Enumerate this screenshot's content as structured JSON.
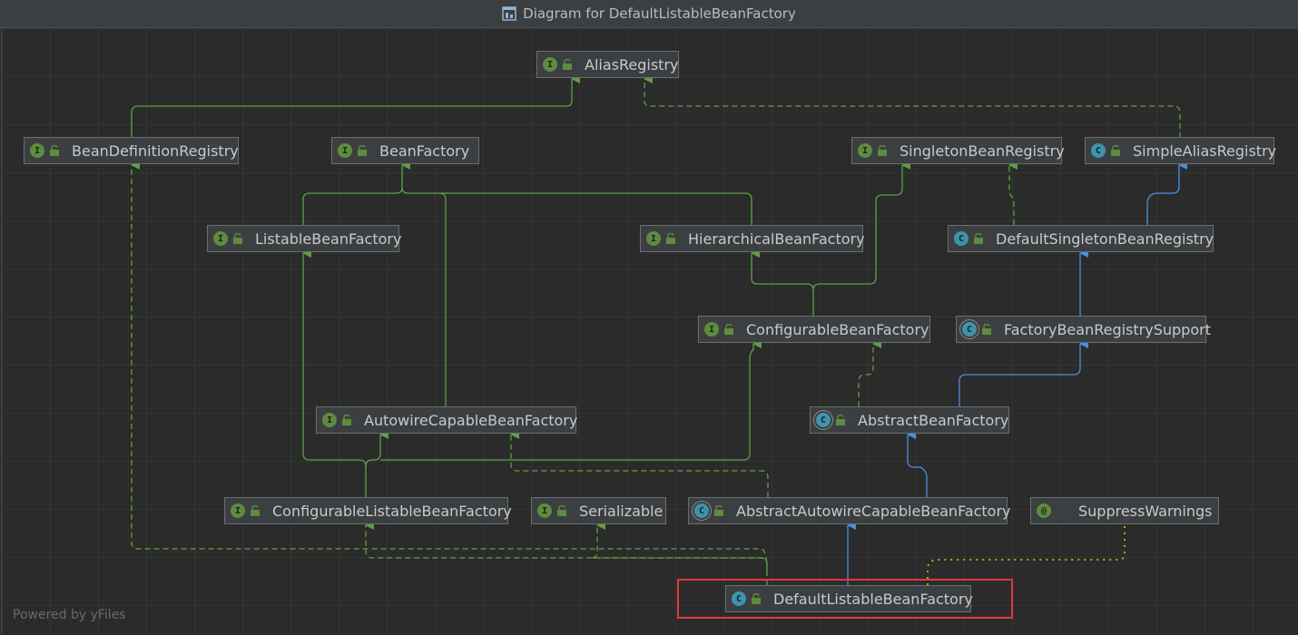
{
  "window": {
    "title": "Diagram for DefaultListableBeanFactory"
  },
  "footer": {
    "powered_by": "Powered by yFiles"
  },
  "colors": {
    "interface_badge": "#5d8c3e",
    "class_badge": "#3e93ad",
    "implements_edge": "#5fa044",
    "extends_edge": "#4a8fe0",
    "annotation_edge": "#b0b000",
    "highlight": "#e03a3a"
  },
  "nodes": {
    "alias_registry": {
      "label": "AliasRegistry",
      "kind": "interface"
    },
    "bean_definition_registry": {
      "label": "BeanDefinitionRegistry",
      "kind": "interface"
    },
    "bean_factory": {
      "label": "BeanFactory",
      "kind": "interface"
    },
    "singleton_bean_registry": {
      "label": "SingletonBeanRegistry",
      "kind": "interface"
    },
    "simple_alias_registry": {
      "label": "SimpleAliasRegistry",
      "kind": "class"
    },
    "listable_bean_factory": {
      "label": "ListableBeanFactory",
      "kind": "interface"
    },
    "hierarchical_bean_factory": {
      "label": "HierarchicalBeanFactory",
      "kind": "interface"
    },
    "default_singleton_bean_registry": {
      "label": "DefaultSingletonBeanRegistry",
      "kind": "class"
    },
    "configurable_bean_factory": {
      "label": "ConfigurableBeanFactory",
      "kind": "interface"
    },
    "factory_bean_registry_support": {
      "label": "FactoryBeanRegistrySupport",
      "kind": "abstract-class"
    },
    "autowire_capable_bean_factory": {
      "label": "AutowireCapableBeanFactory",
      "kind": "interface"
    },
    "abstract_bean_factory": {
      "label": "AbstractBeanFactory",
      "kind": "abstract-class"
    },
    "configurable_listable_bean_factory": {
      "label": "ConfigurableListableBeanFactory",
      "kind": "interface"
    },
    "serializable": {
      "label": "Serializable",
      "kind": "interface"
    },
    "abstract_autowire_capable_bean_factory": {
      "label": "AbstractAutowireCapableBeanFactory",
      "kind": "abstract-class"
    },
    "suppress_warnings": {
      "label": "SuppressWarnings",
      "kind": "annotation"
    },
    "default_listable_bean_factory": {
      "label": "DefaultListableBeanFactory",
      "kind": "class"
    }
  }
}
